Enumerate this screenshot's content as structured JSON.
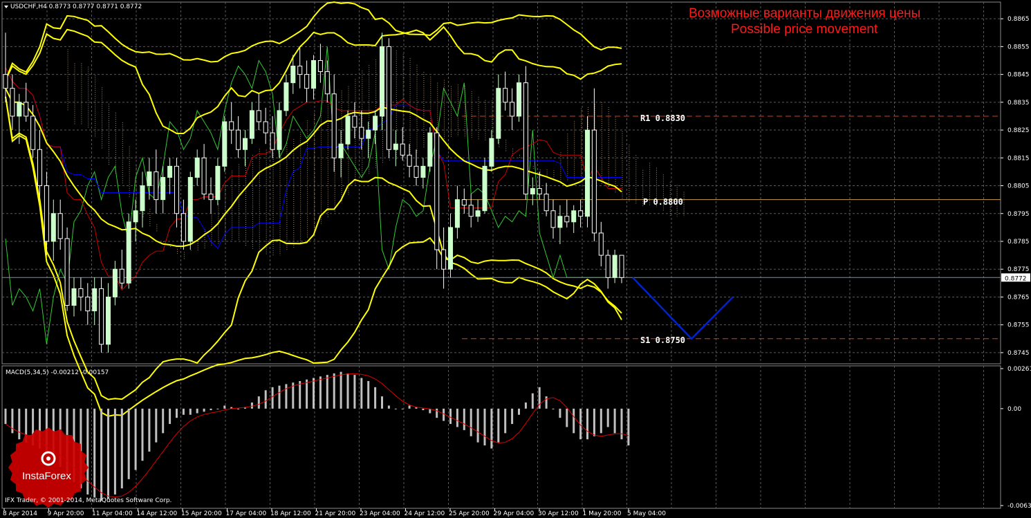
{
  "header": {
    "symbol_line": "USDCHF,H4  0.8773 0.8777 0.8771 0.8772",
    "dropdown_icon": "triangle-down-icon"
  },
  "title": {
    "line1": "Возможные варианты движения цены",
    "line2": "Possible price movement"
  },
  "colors": {
    "bollinger": "#ffff00",
    "candle_up": "#ccffcc",
    "green_line": "#33cc33",
    "red_line": "#cc0000",
    "blue_line": "#0000ff",
    "forecast": "#0022cc",
    "level_line": "#cc4422",
    "pivot_line": "#c8a050",
    "current_price_line": "#7a8fa0",
    "grid": "#5a5a5a",
    "macd_hist": "#c0c0c0",
    "macd_signal": "#dd0000",
    "title_color": "#ff1a1a",
    "logo_bg": "#cc0000"
  },
  "levels": {
    "r1": {
      "label": "R1  0.8830",
      "value": 0.883
    },
    "p": {
      "label": "P  0.8800",
      "value": 0.88
    },
    "s1": {
      "label": "S1  0.8750",
      "value": 0.875
    }
  },
  "price_axis": {
    "ticks": [
      "0.8865",
      "0.8855",
      "0.8845",
      "0.8835",
      "0.8825",
      "0.8815",
      "0.8805",
      "0.8795",
      "0.8785",
      "0.8775",
      "0.8765",
      "0.8755",
      "0.8745"
    ],
    "current_price": "0.8772"
  },
  "time_axis": {
    "ticks": [
      "8 Apr 2014",
      "9 Apr 20:00",
      "11 Apr 04:00",
      "14 Apr 12:00",
      "15 Apr 20:00",
      "17 Apr 04:00",
      "18 Apr 12:00",
      "21 Apr 20:00",
      "23 Apr 04:00",
      "24 Apr 12:00",
      "25 Apr 20:00",
      "29 Apr 04:00",
      "30 Apr 12:00",
      "1 May 20:00",
      "5 May 04:00"
    ]
  },
  "macd": {
    "label": "MACD(5,34,5) -0.00212 -0.00157",
    "ticks": [
      "0.00261",
      "0.00",
      "-0.00632"
    ]
  },
  "footer": {
    "copyright": "IFX Trader, © 2001-2014, MetaQuotes Software Corp."
  },
  "logo": {
    "text": "InstaForex",
    "icon": "instaforex-gear-icon"
  },
  "chart_data": {
    "type": "candlestick",
    "symbol": "USDCHF",
    "timeframe": "H4",
    "ylim": [
      0.8741,
      0.8871
    ],
    "candles": [
      [
        0.8845,
        0.886,
        0.8835,
        0.884
      ],
      [
        0.884,
        0.8845,
        0.8825,
        0.883
      ],
      [
        0.883,
        0.8838,
        0.882,
        0.8835
      ],
      [
        0.8835,
        0.8842,
        0.8828,
        0.883
      ],
      [
        0.883,
        0.8834,
        0.8815,
        0.8818
      ],
      [
        0.8818,
        0.8825,
        0.88,
        0.8805
      ],
      [
        0.8805,
        0.881,
        0.878,
        0.8785
      ],
      [
        0.8785,
        0.88,
        0.8778,
        0.8795
      ],
      [
        0.8795,
        0.88,
        0.8782,
        0.8786
      ],
      [
        0.8786,
        0.879,
        0.876,
        0.8762
      ],
      [
        0.8762,
        0.8772,
        0.8758,
        0.8768
      ],
      [
        0.8768,
        0.8772,
        0.876,
        0.8765
      ],
      [
        0.8765,
        0.877,
        0.8755,
        0.876
      ],
      [
        0.876,
        0.8772,
        0.8755,
        0.8768
      ],
      [
        0.8768,
        0.8772,
        0.8745,
        0.8748
      ],
      [
        0.8748,
        0.877,
        0.8745,
        0.8765
      ],
      [
        0.8765,
        0.8778,
        0.8762,
        0.8775
      ],
      [
        0.8775,
        0.8782,
        0.8768,
        0.877
      ],
      [
        0.877,
        0.8795,
        0.8768,
        0.8792
      ],
      [
        0.8792,
        0.88,
        0.8785,
        0.8796
      ],
      [
        0.8796,
        0.881,
        0.879,
        0.8805
      ],
      [
        0.8805,
        0.8815,
        0.88,
        0.881
      ],
      [
        0.881,
        0.8818,
        0.8795,
        0.88
      ],
      [
        0.88,
        0.8812,
        0.8795,
        0.8808
      ],
      [
        0.8808,
        0.8815,
        0.8802,
        0.8812
      ],
      [
        0.8812,
        0.8815,
        0.879,
        0.8795
      ],
      [
        0.8795,
        0.88,
        0.8782,
        0.8785
      ],
      [
        0.8785,
        0.881,
        0.8782,
        0.8808
      ],
      [
        0.8808,
        0.8818,
        0.8805,
        0.8815
      ],
      [
        0.8815,
        0.882,
        0.88,
        0.8802
      ],
      [
        0.8802,
        0.8808,
        0.8795,
        0.88
      ],
      [
        0.88,
        0.8815,
        0.8798,
        0.8812
      ],
      [
        0.8812,
        0.883,
        0.881,
        0.8828
      ],
      [
        0.8828,
        0.8835,
        0.882,
        0.8825
      ],
      [
        0.8825,
        0.883,
        0.8815,
        0.8818
      ],
      [
        0.8818,
        0.8825,
        0.8812,
        0.8822
      ],
      [
        0.8822,
        0.8835,
        0.882,
        0.8832
      ],
      [
        0.8832,
        0.8838,
        0.8825,
        0.8828
      ],
      [
        0.8828,
        0.8833,
        0.882,
        0.8824
      ],
      [
        0.8824,
        0.883,
        0.8815,
        0.8818
      ],
      [
        0.8818,
        0.8835,
        0.8815,
        0.8832
      ],
      [
        0.8832,
        0.8845,
        0.883,
        0.8842
      ],
      [
        0.8842,
        0.8852,
        0.8838,
        0.8848
      ],
      [
        0.8848,
        0.8855,
        0.884,
        0.8845
      ],
      [
        0.8845,
        0.885,
        0.8835,
        0.884
      ],
      [
        0.884,
        0.8852,
        0.8836,
        0.885
      ],
      [
        0.885,
        0.8856,
        0.8842,
        0.8846
      ],
      [
        0.8846,
        0.885,
        0.8835,
        0.8838
      ],
      [
        0.8838,
        0.8845,
        0.881,
        0.8815
      ],
      [
        0.8815,
        0.8825,
        0.8808,
        0.882
      ],
      [
        0.882,
        0.8832,
        0.8818,
        0.883
      ],
      [
        0.883,
        0.8835,
        0.8822,
        0.8826
      ],
      [
        0.8826,
        0.8832,
        0.8818,
        0.8822
      ],
      [
        0.8822,
        0.8828,
        0.8815,
        0.8825
      ],
      [
        0.8825,
        0.8832,
        0.882,
        0.883
      ],
      [
        0.883,
        0.886,
        0.8825,
        0.8855
      ],
      [
        0.8855,
        0.8858,
        0.8815,
        0.8818
      ],
      [
        0.8818,
        0.8825,
        0.8812,
        0.882
      ],
      [
        0.882,
        0.8826,
        0.8814,
        0.8816
      ],
      [
        0.8816,
        0.882,
        0.8808,
        0.8812
      ],
      [
        0.8812,
        0.8818,
        0.8805,
        0.8808
      ],
      [
        0.8808,
        0.8815,
        0.8804,
        0.8812
      ],
      [
        0.8812,
        0.8826,
        0.881,
        0.8824
      ],
      [
        0.8824,
        0.8826,
        0.8775,
        0.8782
      ],
      [
        0.8782,
        0.879,
        0.8768,
        0.8775
      ],
      [
        0.8775,
        0.8795,
        0.8772,
        0.879
      ],
      [
        0.879,
        0.8805,
        0.8786,
        0.88
      ],
      [
        0.88,
        0.8804,
        0.8795,
        0.8798
      ],
      [
        0.8798,
        0.8802,
        0.879,
        0.8794
      ],
      [
        0.8794,
        0.88,
        0.8792,
        0.8796
      ],
      [
        0.8796,
        0.8815,
        0.8795,
        0.8812
      ],
      [
        0.8812,
        0.8825,
        0.881,
        0.8822
      ],
      [
        0.8822,
        0.8845,
        0.882,
        0.884
      ],
      [
        0.884,
        0.8846,
        0.8832,
        0.8835
      ],
      [
        0.8835,
        0.884,
        0.8825,
        0.883
      ],
      [
        0.883,
        0.8845,
        0.8828,
        0.8842
      ],
      [
        0.8842,
        0.8848,
        0.88,
        0.8802
      ],
      [
        0.8802,
        0.8808,
        0.8798,
        0.8804
      ],
      [
        0.8804,
        0.881,
        0.88,
        0.8802
      ],
      [
        0.8802,
        0.8806,
        0.8794,
        0.8796
      ],
      [
        0.8796,
        0.88,
        0.8786,
        0.879
      ],
      [
        0.879,
        0.8798,
        0.8784,
        0.8794
      ],
      [
        0.8794,
        0.88,
        0.879,
        0.8792
      ],
      [
        0.8792,
        0.8798,
        0.8788,
        0.8796
      ],
      [
        0.8796,
        0.88,
        0.879,
        0.8794
      ],
      [
        0.8794,
        0.883,
        0.879,
        0.8825
      ],
      [
        0.8825,
        0.884,
        0.8785,
        0.8788
      ],
      [
        0.8788,
        0.8792,
        0.8776,
        0.878
      ],
      [
        0.878,
        0.8782,
        0.8768,
        0.8772
      ],
      [
        0.8772,
        0.8782,
        0.877,
        0.878
      ],
      [
        0.878,
        0.878,
        0.877,
        0.8772
      ]
    ],
    "forecast_path": [
      [
        0,
        0.8772
      ],
      [
        1,
        0.875
      ],
      [
        2,
        0.8765
      ]
    ],
    "macd_hist": [
      -0.001,
      -0.0016,
      -0.002,
      -0.0022,
      -0.0024,
      -0.0026,
      -0.003,
      -0.0034,
      -0.0038,
      -0.0042,
      -0.0048,
      -0.0052,
      -0.0056,
      -0.0058,
      -0.006,
      -0.0059,
      -0.0056,
      -0.0052,
      -0.0046,
      -0.004,
      -0.0034,
      -0.0028,
      -0.0022,
      -0.0016,
      -0.001,
      -0.0006,
      -0.0004,
      -0.0004,
      -0.0003,
      -0.0002,
      -0.0001,
      0.0,
      0.0002,
      0.0001,
      0.0,
      0.0001,
      0.0004,
      0.0008,
      0.0012,
      0.0014,
      0.0015,
      0.0016,
      0.0017,
      0.0018,
      0.0019,
      0.002,
      0.0021,
      0.0022,
      0.0023,
      0.0024,
      0.0023,
      0.0022,
      0.002,
      0.0018,
      0.0014,
      0.0008,
      0.0002,
      0.0,
      0.0,
      0.0002,
      0.0001,
      -0.0001,
      -0.0003,
      -0.0006,
      -0.0008,
      -0.001,
      -0.0012,
      -0.0014,
      -0.0018,
      -0.0022,
      -0.0024,
      -0.0026,
      -0.0022,
      -0.0016,
      -0.001,
      -0.0004,
      0.0004,
      0.001,
      0.0014,
      0.0008,
      0.0,
      -0.0006,
      -0.0012,
      -0.0016,
      -0.002,
      -0.002,
      -0.0018,
      -0.0016,
      -0.0012,
      -0.0016,
      -0.002,
      -0.0024
    ]
  }
}
